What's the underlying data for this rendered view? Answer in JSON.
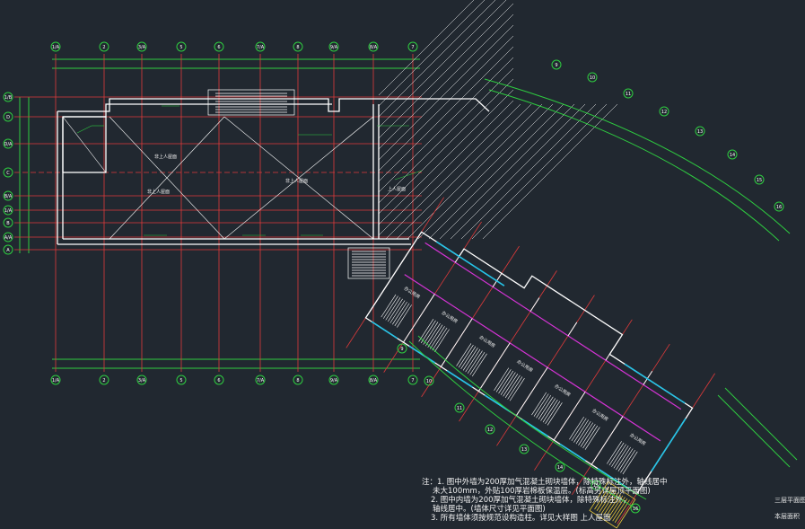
{
  "colors": {
    "background": "#212830",
    "wall": "#ffffff",
    "axis": "#e03a3a",
    "dimension": "#2ecc40",
    "partition": "#d633d6",
    "window": "#25c4e8",
    "stair": "#ffffff",
    "stair_highlight": "#e8c83a",
    "text": "#f2f2f2"
  },
  "top_axis_labels": [
    "1/A",
    "2",
    "3/A",
    "5",
    "6",
    "7/A",
    "8",
    "9/A",
    "8/A",
    "7"
  ],
  "left_axis_labels": [
    "1/B",
    "D",
    "D/A",
    "C",
    "B/A",
    "1/A",
    "B",
    "A/A",
    "A"
  ],
  "right_axis_labels": [
    "9",
    "10",
    "11",
    "12",
    "13",
    "14",
    "15",
    "16"
  ],
  "room_labels": [
    "办公用房",
    "办公用房",
    "办公用房",
    "办公用房",
    "办公用房",
    "办公用房",
    "办公用房",
    "办公用房"
  ],
  "roof_labels": [
    "非上人屋面",
    "非上人屋面",
    "非上人屋面",
    "上人屋面"
  ],
  "notes": {
    "line1": "注：1. 图中外墙为200厚加气混凝土砌块墙体，除特殊标注外，轴线居中",
    "line1b": "未大100mm，外贴100厚岩棉板保温层。(标高另详屋顶平面图)",
    "line2": "2. 图中内墙为200厚加气混凝土砌块墙体，除特殊标注外，",
    "line2b": "轴线居中。(墙体尺寸详见平面图)",
    "line3": "3. 所有墙体须按规范设构造柱。详见大样图",
    "tail": "上人屋面"
  },
  "title_block": {
    "title": "三层平面图",
    "subtitle": "本层面积"
  }
}
